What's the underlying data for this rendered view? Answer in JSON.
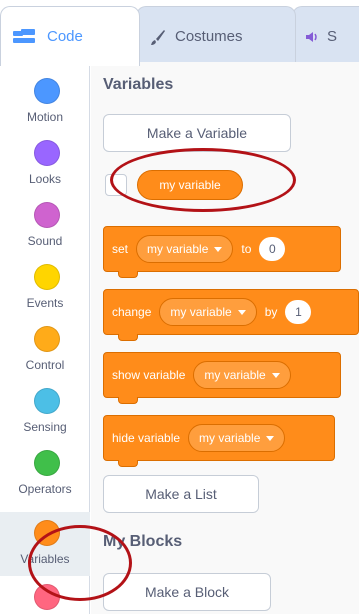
{
  "tabs": [
    {
      "label": "Code",
      "icon": "code-icon"
    },
    {
      "label": "Costumes",
      "icon": "brush-icon"
    },
    {
      "label": "S",
      "icon": "speaker-icon"
    }
  ],
  "categories": [
    {
      "label": "Motion",
      "color": "#4c97ff"
    },
    {
      "label": "Looks",
      "color": "#9966ff"
    },
    {
      "label": "Sound",
      "color": "#cf63cf"
    },
    {
      "label": "Events",
      "color": "#ffd500"
    },
    {
      "label": "Control",
      "color": "#ffab19"
    },
    {
      "label": "Sensing",
      "color": "#4cbfe6"
    },
    {
      "label": "Operators",
      "color": "#40bf4a"
    },
    {
      "label": "Variables",
      "color": "#ff8c1a"
    },
    {
      "label": "",
      "color": "#ff6680"
    }
  ],
  "palette": {
    "variables_title": "Variables",
    "make_variable": "Make a Variable",
    "reporter": "my variable",
    "blocks": {
      "set": {
        "label": "set",
        "dropdown": "my variable",
        "to_label": "to",
        "value": "0"
      },
      "change": {
        "label": "change",
        "dropdown": "my variable",
        "by_label": "by",
        "value": "1"
      },
      "show": {
        "label": "show variable",
        "dropdown": "my variable"
      },
      "hide": {
        "label": "hide variable",
        "dropdown": "my variable"
      }
    },
    "make_list": "Make a List",
    "my_blocks_title": "My Blocks",
    "make_block": "Make a Block"
  },
  "colors": {
    "accent": "#4c97ff",
    "variables_block": "#ff8c1a",
    "annotation": "#b31217"
  }
}
